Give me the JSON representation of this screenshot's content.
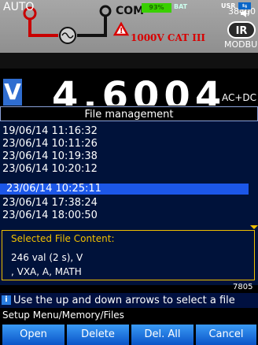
{
  "header": {
    "com_label": "COM",
    "category_label": "1000V CAT III",
    "baud": "38400",
    "ir_label": "IR",
    "modbus_label": "MODBUS"
  },
  "status": {
    "mode": "AUTO",
    "battery_percent": "93%",
    "battery_label": "BAT",
    "user_label": "USR"
  },
  "display": {
    "unit_badge": "V",
    "reading": "4.6004",
    "coupling": "AC+DC",
    "partial_value": "7805"
  },
  "dialog": {
    "title": "File management",
    "files": [
      "19/06/14 11:16:32",
      "23/06/14 10:11:26",
      "23/06/14 10:19:38",
      "23/06/14 10:20:12",
      "23/06/14 10:25:11",
      "23/06/14 17:38:24",
      "23/06/14 18:00:50"
    ],
    "selected_index": 4,
    "content_title": "Selected File Content:",
    "content_lines": [
      "246 val (2 s), V",
      ", VXA, A, MATH"
    ]
  },
  "hint": "Use the up and down arrows to select a file",
  "breadcrumb": "Setup Menu/Memory/Files",
  "softkeys": [
    "Open",
    "Delete",
    "Del. All",
    "Cancel"
  ],
  "colors": {
    "accent_blue": "#1c57e8",
    "content_border": "#f0c000",
    "warning_red": "#d80000"
  }
}
